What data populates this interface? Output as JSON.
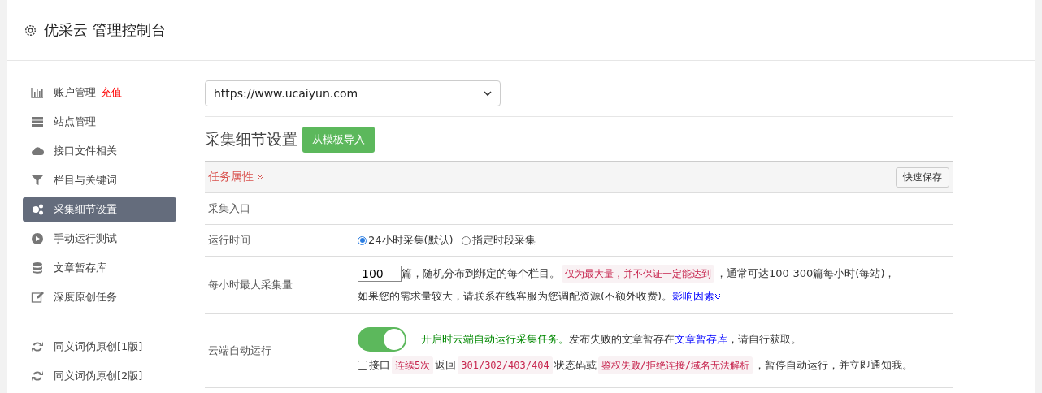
{
  "header": {
    "title": "优采云 管理控制台"
  },
  "sidebar": {
    "groups": [
      {
        "items": [
          {
            "label": "账户管理",
            "badge": "充值",
            "selected": false
          },
          {
            "label": "站点管理",
            "selected": false
          },
          {
            "label": "接口文件相关",
            "selected": false
          },
          {
            "label": "栏目与关键词",
            "selected": false
          },
          {
            "label": "采集细节设置",
            "selected": true
          },
          {
            "label": "手动运行测试",
            "selected": false
          },
          {
            "label": "文章暂存库",
            "selected": false
          },
          {
            "label": "深度原创任务",
            "selected": false
          }
        ]
      },
      {
        "items": [
          {
            "label": "同义词伪原创[1版]",
            "selected": false
          },
          {
            "label": "同义词伪原创[2版]",
            "selected": false
          }
        ]
      }
    ]
  },
  "site_select": {
    "value": "https://www.ucaiyun.com"
  },
  "section": {
    "title": "采集细节设置",
    "import_button": "从模板导入"
  },
  "panel": {
    "heading": "任务属性",
    "save_button": "快速保存",
    "rows": [
      {
        "label": "采集入口",
        "kind": "blank"
      },
      {
        "label": "运行时间",
        "kind": "radios",
        "options": [
          {
            "label": "24小时采集(默认)",
            "selected": true
          },
          {
            "label": "指定时段采集",
            "selected": false
          }
        ]
      },
      {
        "label": "每小时最大采集量",
        "kind": "rich",
        "lines": [
          [
            {
              "kind": "field",
              "text": "100"
            },
            {
              "kind": "text",
              "text": "篇，随机分布到绑定的每个栏目。"
            },
            {
              "kind": "code",
              "text": "仅为最大量，并不保证一定能达到"
            },
            {
              "kind": "text",
              "text": "，通常可达100-300篇每小时(每站)，"
            }
          ],
          [
            {
              "kind": "text",
              "text": "如果您的需求量较大，请联系在线客服为您调配资源(不额外收费)。"
            },
            {
              "kind": "expand_link",
              "text": "影响因素"
            }
          ]
        ]
      },
      {
        "label": "云端自动运行",
        "kind": "rich",
        "lines": [
          [
            {
              "kind": "toggle",
              "on": true
            },
            {
              "kind": "green",
              "text": "开启时云端自动运行采集任务。"
            },
            {
              "kind": "text",
              "text": "发布失败的文章暂存在"
            },
            {
              "kind": "link",
              "text": "文章暂存库"
            },
            {
              "kind": "text",
              "text": "，请自行获取。"
            }
          ],
          [
            {
              "kind": "checkbox",
              "checked": false,
              "text": "接口"
            },
            {
              "kind": "code",
              "text": "连续5次"
            },
            {
              "kind": "text",
              "text": "返回"
            },
            {
              "kind": "code",
              "text": "301/302/403/404"
            },
            {
              "kind": "text",
              "text": "状态码或"
            },
            {
              "kind": "code",
              "text": "鉴权失败/拒绝连接/域名无法解析"
            },
            {
              "kind": "text",
              "text": "，暂停自动运行，并立即通知我。"
            }
          ]
        ]
      }
    ]
  }
}
